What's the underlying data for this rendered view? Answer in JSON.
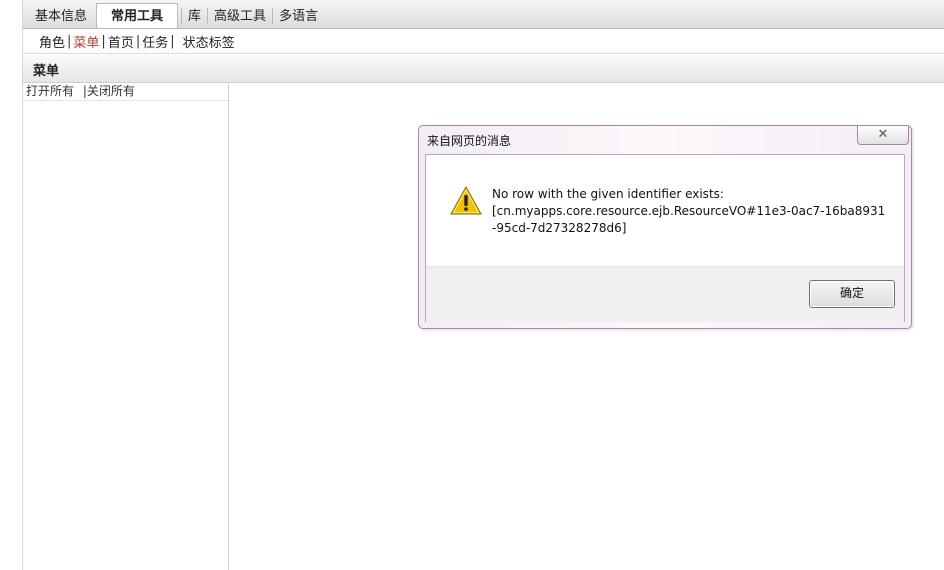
{
  "top_tabs": [
    {
      "label": "基本信息",
      "active": false
    },
    {
      "label": "常用工具",
      "active": true
    },
    {
      "label": "库",
      "active": false
    },
    {
      "label": "高级工具",
      "active": false
    },
    {
      "label": "多语言",
      "active": false
    }
  ],
  "sub_menu": [
    {
      "label": "角色",
      "active": false
    },
    {
      "label": "菜单",
      "active": true
    },
    {
      "label": "首页",
      "active": false
    },
    {
      "label": "任务",
      "active": false
    },
    {
      "label": "状态标签",
      "active": false
    }
  ],
  "section": {
    "title": "菜单"
  },
  "left_panel": {
    "open_all": "打开所有",
    "separator": "|",
    "close_all": "关闭所有"
  },
  "dialog": {
    "title": "来自网页的消息",
    "close_symbol": "✕",
    "message_lines": [
      "No row with the given identifier exists:",
      "[cn.myapps.core.resource.ejb.ResourceVO#11e3-0ac7-16ba8931",
      "-95cd-7d27328278d6]"
    ],
    "icon": "warning-icon",
    "ok_label": "确定"
  },
  "colors": {
    "active_sub": "#c0392b",
    "warning": "#f2c200"
  }
}
